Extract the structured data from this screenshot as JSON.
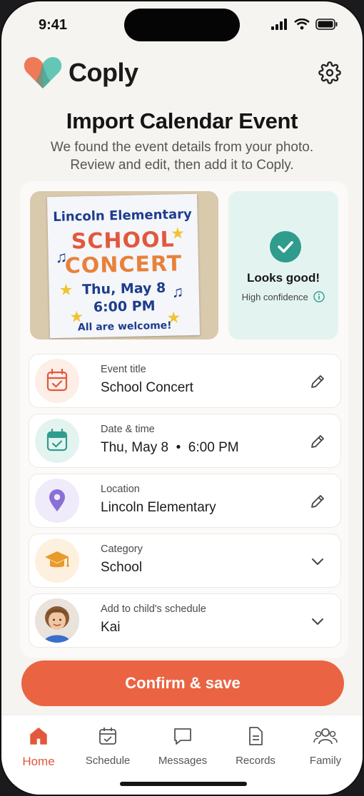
{
  "status": {
    "time": "9:41"
  },
  "app": {
    "name": "Coply"
  },
  "page": {
    "title": "Import Calendar Event",
    "subtitle": "We found the event details from your photo. Review and edit, then add it to Coply."
  },
  "photo": {
    "line1": "Lincoln Elementary",
    "line2": "SCHOOL",
    "line3": "CONCERT",
    "line4": "Thu, May 8",
    "line5": "6:00 PM",
    "line6": "All are welcome!"
  },
  "confidence": {
    "title": "Looks good!",
    "detail": "High confidence"
  },
  "fields": [
    {
      "label": "Event title",
      "value": "School Concert",
      "icon": "calendar-check-icon",
      "action": "edit-icon"
    },
    {
      "label": "Date & time",
      "value": "Thu, May 8  •  6:00 PM",
      "icon": "calendar-check-icon",
      "action": "edit-icon"
    },
    {
      "label": "Location",
      "value": "Lincoln Elementary",
      "icon": "location-pin-icon",
      "action": "edit-icon"
    },
    {
      "label": "Category",
      "value": "School",
      "icon": "graduation-cap-icon",
      "action": "chevron-down-icon"
    },
    {
      "label": "Add to child's schedule",
      "value": "Kai",
      "icon": "child-avatar",
      "action": "chevron-down-icon"
    }
  ],
  "confirm_label": "Confirm & save",
  "tabs": [
    {
      "label": "Home",
      "icon": "home-icon",
      "active": true
    },
    {
      "label": "Schedule",
      "icon": "calendar-icon"
    },
    {
      "label": "Messages",
      "icon": "message-icon"
    },
    {
      "label": "Records",
      "icon": "document-icon"
    },
    {
      "label": "Family",
      "icon": "people-icon"
    }
  ],
  "colors": {
    "accent": "#ea6443",
    "teal": "#2f9c8d",
    "background": "#f6f4f1"
  }
}
